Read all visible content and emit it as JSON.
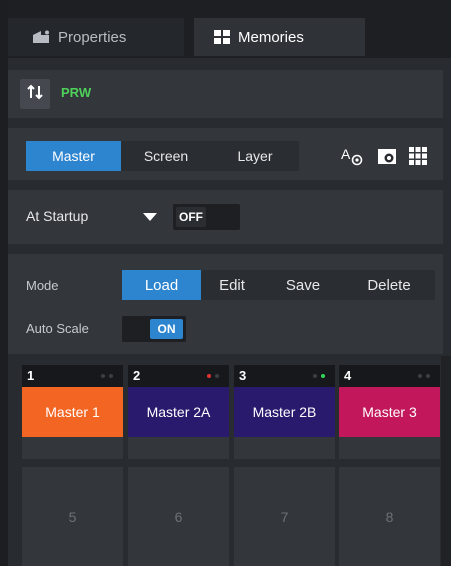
{
  "tabs": [
    {
      "label": "Properties",
      "icon": "properties-icon"
    },
    {
      "label": "Memories",
      "icon": "memories-grid-icon"
    }
  ],
  "toolbar": {
    "prw_label": "PRW",
    "sort_icon": "sort-arrows-icon"
  },
  "target_tabs": [
    "Master",
    "Screen",
    "Layer"
  ],
  "target_icons": [
    "text-visibility-icon",
    "eye-icon",
    "grid-icon"
  ],
  "startup": {
    "label": "At Startup",
    "value": "OFF"
  },
  "mode": {
    "label": "Mode",
    "options": [
      "Load",
      "Edit",
      "Save",
      "Delete"
    ],
    "selected": "Load"
  },
  "auto_scale": {
    "label": "Auto Scale",
    "value": "ON"
  },
  "memories": [
    {
      "number": "1",
      "name": "Master 1",
      "color": "#f26522",
      "dot1": "#3a3d42",
      "dot2": "#3a3d42"
    },
    {
      "number": "2",
      "name": "Master 2A",
      "color": "#2a1a6e",
      "dot1": "#e0302f",
      "dot2": "#3a3d42"
    },
    {
      "number": "3",
      "name": "Master 2B",
      "color": "#2a1a6e",
      "dot1": "#3a3d42",
      "dot2": "#33d45a"
    },
    {
      "number": "4",
      "name": "Master 3",
      "color": "#c2185b",
      "dot1": "#3a3d42",
      "dot2": "#3a3d42"
    }
  ],
  "empty_slots": [
    "5",
    "6",
    "7",
    "8"
  ],
  "colors": {
    "accent": "#2d84cf",
    "prw_green": "#4ed15a"
  }
}
